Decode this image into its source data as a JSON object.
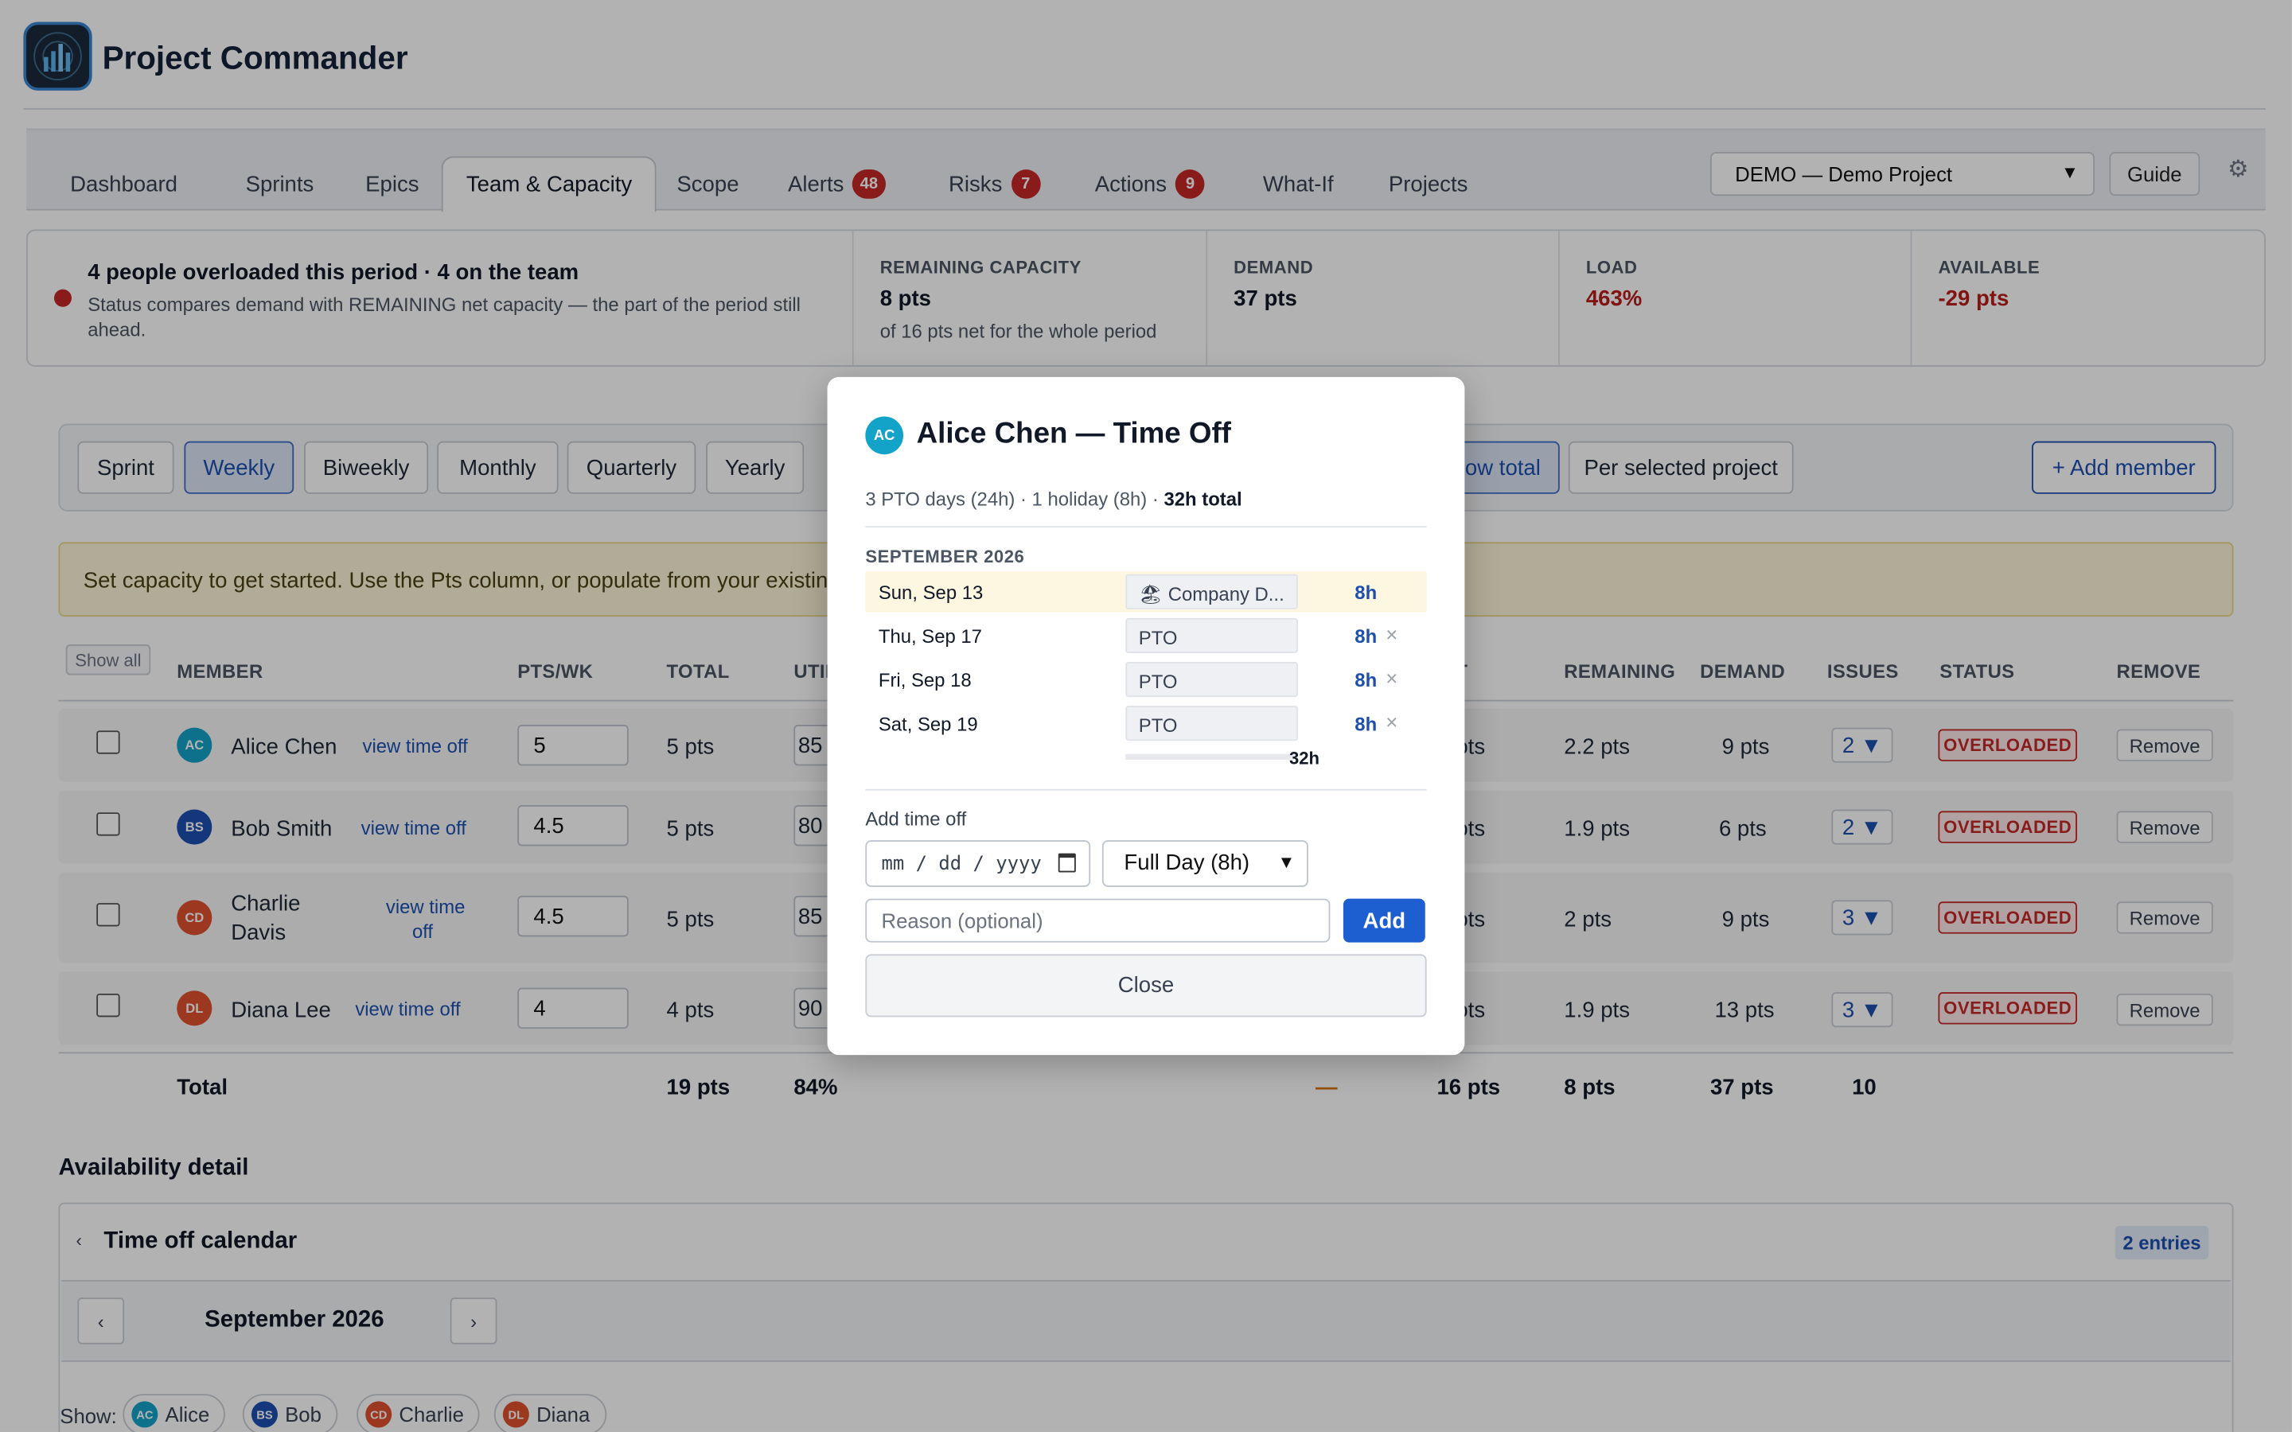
{
  "app": {
    "title": "Project Commander"
  },
  "nav": {
    "tabs": [
      {
        "label": "Dashboard"
      },
      {
        "label": "Sprints"
      },
      {
        "label": "Epics"
      },
      {
        "label": "Team & Capacity"
      },
      {
        "label": "Scope"
      },
      {
        "label": "Alerts",
        "badge": "48"
      },
      {
        "label": "Risks",
        "badge": "7"
      },
      {
        "label": "Actions",
        "badge": "9"
      },
      {
        "label": "What-If"
      },
      {
        "label": "Projects"
      }
    ],
    "active_tab": "Team & Capacity",
    "project_select": "DEMO — Demo Project",
    "guide_label": "Guide"
  },
  "summary": {
    "headline": "4 people overloaded this period · 4 on the team",
    "subtext": "Status compares demand with REMAINING net capacity — the part of the period still ahead.",
    "remaining_capacity": {
      "label": "REMAINING CAPACITY",
      "value": "8 pts",
      "note": "of 16 pts net for the whole period"
    },
    "demand": {
      "label": "DEMAND",
      "value": "37 pts"
    },
    "load": {
      "label": "LOAD",
      "value": "463%"
    },
    "available": {
      "label": "AVAILABLE",
      "value": "-29 pts"
    }
  },
  "toolbar": {
    "periods": [
      "Sprint",
      "Weekly",
      "Biweekly",
      "Monthly",
      "Quarterly",
      "Yearly"
    ],
    "selected_period": "Weekly",
    "show_total_fragment": "ow total",
    "per_project": "Per selected project",
    "add_member": "+ Add member"
  },
  "banner": "Set capacity to get started. Use the Pts column, or populate from your existing rat",
  "table": {
    "show_all": "Show all",
    "headers": {
      "member": "MEMBER",
      "pts_wk": "PTS/WK",
      "total": "TOTAL",
      "util": "UTIL",
      "net_fragment": "T",
      "remaining": "REMAINING",
      "demand": "DEMAND",
      "issues": "ISSUES",
      "status": "STATUS",
      "remove": "REMOVE"
    },
    "rows": [
      {
        "initials": "AC",
        "color": "#14a3c8",
        "name": "Alice Chen",
        "link": "view time off",
        "pts": "5",
        "total": "5 pts",
        "util": "85",
        "net": "ots",
        "remaining": "2.2 pts",
        "demand": "9 pts",
        "issues": "2 ▼",
        "status": "OVERLOADED",
        "remove": "Remove"
      },
      {
        "initials": "BS",
        "color": "#1d4fb0",
        "name": "Bob Smith",
        "link": "view time off",
        "pts": "4.5",
        "total": "5 pts",
        "util": "80",
        "net": "ots",
        "remaining": "1.9 pts",
        "demand": "6 pts",
        "issues": "2 ▼",
        "status": "OVERLOADED",
        "remove": "Remove"
      },
      {
        "initials": "CD",
        "color": "#e0502f",
        "name_line1": "Charlie",
        "name_line2": "Davis",
        "link_line1": "view time",
        "link_line2": "off",
        "pts": "4.5",
        "total": "5 pts",
        "util": "85",
        "net": "ots",
        "remaining": "2 pts",
        "demand": "9 pts",
        "issues": "3 ▼",
        "status": "OVERLOADED",
        "remove": "Remove"
      },
      {
        "initials": "DL",
        "color": "#e0502f",
        "name": "Diana Lee",
        "link": "view time off",
        "pts": "4",
        "total": "4 pts",
        "util": "90",
        "net": "ots",
        "remaining": "1.9 pts",
        "demand": "13 pts",
        "issues": "3 ▼",
        "status": "OVERLOADED",
        "remove": "Remove"
      }
    ],
    "totals": {
      "label": "Total",
      "total": "19 pts",
      "util": "84%",
      "dash": "—",
      "net": "16 pts",
      "remaining": "8 pts",
      "demand": "37 pts",
      "issues": "10"
    }
  },
  "availability": {
    "title": "Availability detail",
    "calendar_title": "Time off calendar",
    "entries": "2 entries",
    "month": "September 2026",
    "prev": "‹",
    "next": "›",
    "show_label": "Show:",
    "people": [
      {
        "initials": "AC",
        "name": "Alice",
        "color": "#14a3c8"
      },
      {
        "initials": "BS",
        "name": "Bob",
        "color": "#1d4fb0"
      },
      {
        "initials": "CD",
        "name": "Charlie",
        "color": "#e0502f"
      },
      {
        "initials": "DL",
        "name": "Diana",
        "color": "#e0502f"
      }
    ]
  },
  "modal": {
    "initials": "AC",
    "title": "Alice Chen — Time Off",
    "summary_prefix": "3 PTO days (24h) · 1 holiday (8h) · ",
    "summary_total": "32h total",
    "month": "SEPTEMBER 2026",
    "entries": [
      {
        "date": "Sun, Sep 13",
        "type": "🏖 Company D...",
        "hours": "8h",
        "holiday": true
      },
      {
        "date": "Thu, Sep 17",
        "type": "PTO",
        "hours": "8h",
        "holiday": false
      },
      {
        "date": "Fri, Sep 18",
        "type": "PTO",
        "hours": "8h",
        "holiday": false
      },
      {
        "date": "Sat, Sep 19",
        "type": "PTO",
        "hours": "8h",
        "holiday": false
      }
    ],
    "total_hours": "32h",
    "add_label": "Add time off",
    "date_placeholder": "mm / dd / yyyy",
    "duration": "Full Day (8h)",
    "reason_placeholder": "Reason (optional)",
    "add_button": "Add",
    "close_button": "Close",
    "remove_glyph": "×"
  }
}
